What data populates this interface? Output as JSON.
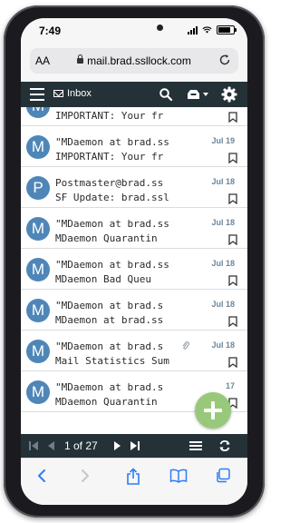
{
  "status_bar": {
    "time": "7:49"
  },
  "address_bar": {
    "text_size_label": "AA",
    "url": "mail.brad.ssllock.com"
  },
  "toolbar": {
    "folder_label": "Inbox"
  },
  "messages": [
    {
      "avatar": "M",
      "from": "",
      "subject": "IMPORTANT: Your fr",
      "date": "",
      "attachment": false
    },
    {
      "avatar": "M",
      "from": "\"MDaemon at brad.ss",
      "subject": "IMPORTANT: Your fr",
      "date": "Jul 19",
      "attachment": false
    },
    {
      "avatar": "P",
      "from": "Postmaster@brad.ss",
      "subject": "SF Update: brad.ssll",
      "date": "Jul 18",
      "attachment": false
    },
    {
      "avatar": "M",
      "from": "\"MDaemon at brad.ss",
      "subject": "MDaemon Quarantin",
      "date": "Jul 18",
      "attachment": false
    },
    {
      "avatar": "M",
      "from": "\"MDaemon at brad.ss",
      "subject": "MDaemon Bad Queu",
      "date": "Jul 18",
      "attachment": false
    },
    {
      "avatar": "M",
      "from": "\"MDaemon at brad.s",
      "subject": "MDaemon at brad.ss",
      "date": "Jul 18",
      "attachment": false
    },
    {
      "avatar": "M",
      "from": "\"MDaemon at brad.s",
      "subject": "Mail Statistics Summ",
      "date": "Jul 18",
      "attachment": true
    },
    {
      "avatar": "M",
      "from": "\"MDaemon at brad.s",
      "subject": "MDaemon Quarantin",
      "date": "17",
      "attachment": false
    }
  ],
  "pager": {
    "text": "1 of 27"
  },
  "colors": {
    "toolbar_bg": "#243238",
    "avatar": "#4f86b8",
    "fab": "#98c97a",
    "date": "#6b8699",
    "safari_blue": "#2f7bf5"
  }
}
